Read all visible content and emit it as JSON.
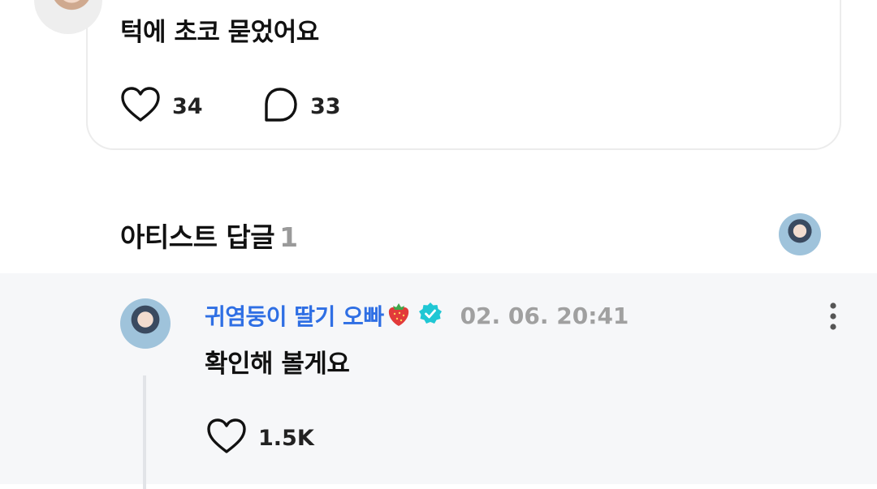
{
  "post": {
    "text": "턱에 초코 묻었어요",
    "likes": "34",
    "comments": "33"
  },
  "artist_replies": {
    "title": "아티스트 답글",
    "count": "1"
  },
  "reply": {
    "author": "귀염둥이 딸기 오빠",
    "timestamp": "02. 06. 20:41",
    "text": "확인해 볼게요",
    "likes": "1.5K"
  },
  "icons": {
    "like": "heart-outline-icon",
    "comment": "speech-bubble-icon",
    "verified": "verified-badge-icon",
    "more": "vertical-ellipsis-icon",
    "emoji": "strawberry-emoji"
  },
  "colors": {
    "author_name": "#2f6fe4",
    "verified_badge": "#1fc7d4",
    "timestamp": "#a0a0a0",
    "reply_background": "#f6f7f9"
  }
}
